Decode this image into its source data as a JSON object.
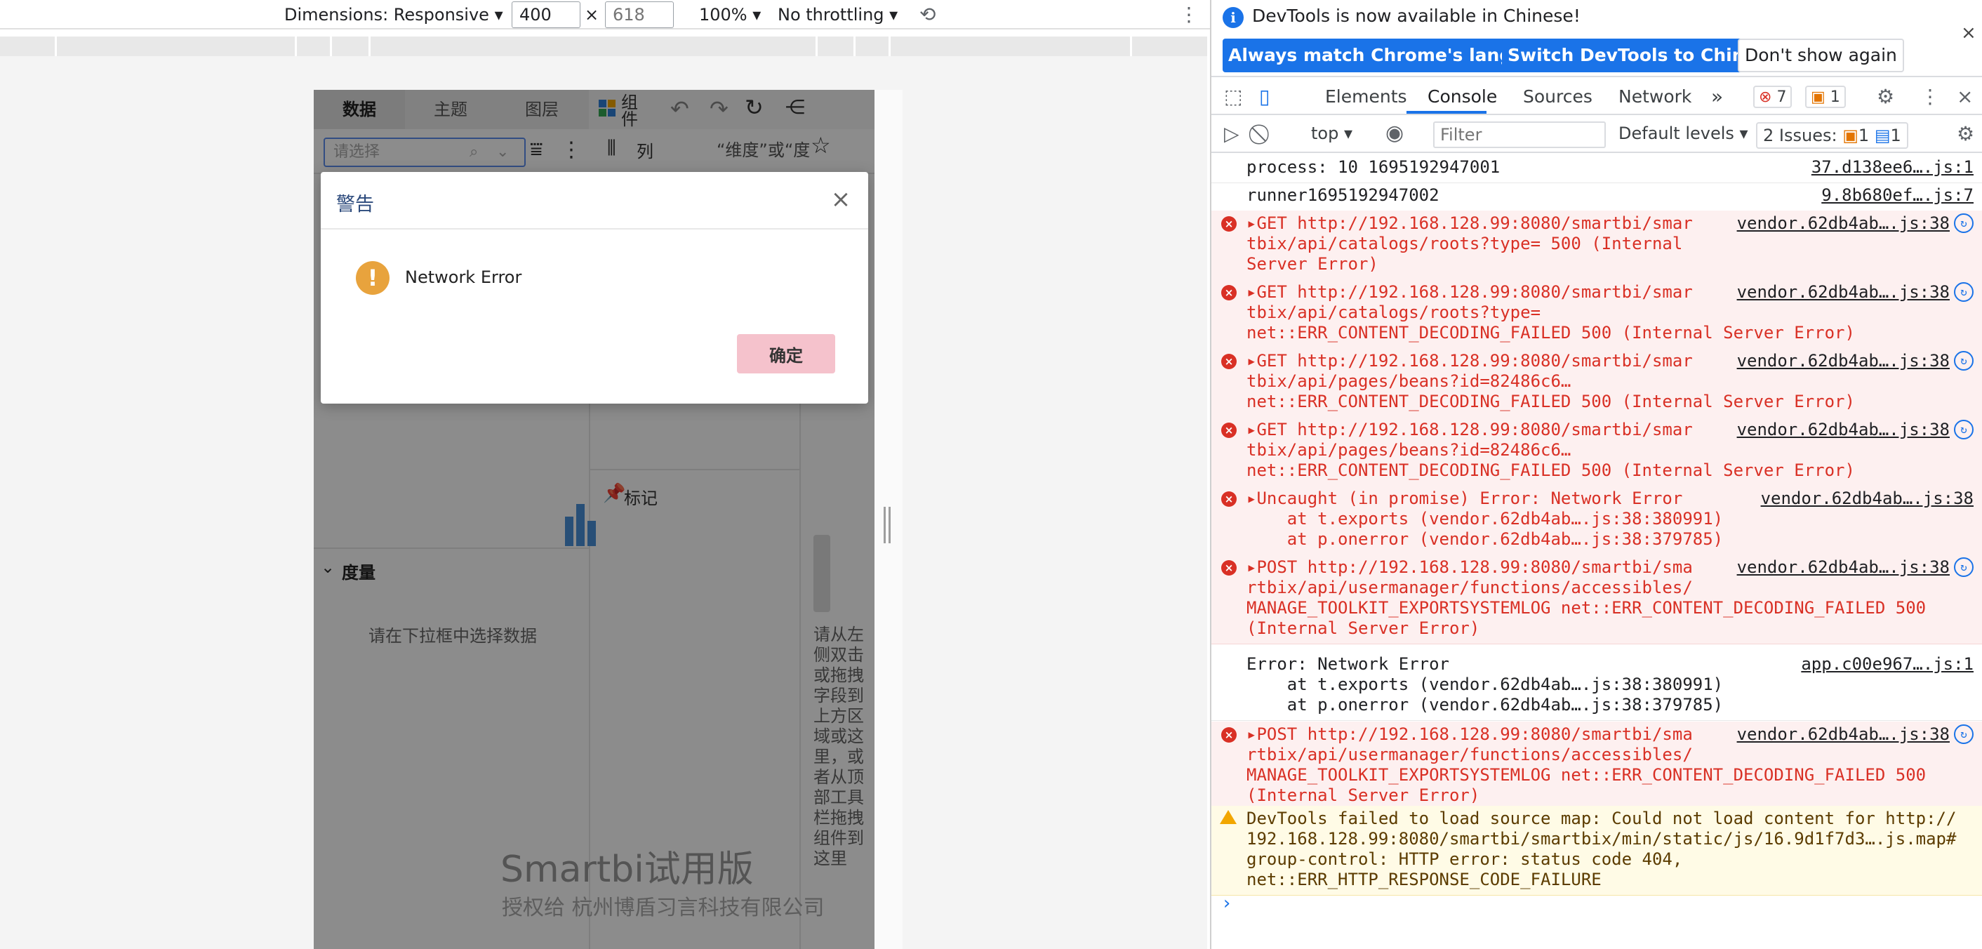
{
  "device_toolbar": {
    "dimensions_label": "Dimensions: Responsive",
    "width_value": "400",
    "height_placeholder": "618",
    "times": "×",
    "zoom": "100%",
    "throttling": "No throttling"
  },
  "app": {
    "tabs": [
      "数据",
      "主题",
      "图层"
    ],
    "components_label": "组件",
    "select_placeholder": "请选择",
    "columns_label": "列",
    "hint_top": "“维度”或“度",
    "marks_label": "标记",
    "measures_label": "度量",
    "select_data_hint": "请在下拉框中选择数据",
    "side_hint": "请从左侧双击或拖拽字段到上方区域或这里，或者从顶部工具栏拖拽组件到这里",
    "watermark_title": "Smartbi试用版",
    "watermark_sub": "授权给 杭州博盾习言科技有限公司"
  },
  "dialog": {
    "title": "警告",
    "message": "Network Error",
    "ok": "确定"
  },
  "devtools": {
    "info_text": "DevTools is now available in Chinese!",
    "btn_match": "Always match Chrome's language",
    "btn_switch": "Switch DevTools to Chinese",
    "btn_dont": "Don't show again",
    "tabs": [
      "Elements",
      "Console",
      "Sources",
      "Network"
    ],
    "errors_count": "7",
    "warnings_count": "1",
    "context": "top",
    "filter_placeholder": "Filter",
    "levels": "Default levels",
    "issues_label": "2 Issues:",
    "issues_warn": "1",
    "issues_info": "1"
  },
  "console": [
    {
      "type": "log",
      "lines": [
        "process: 10 1695192947001"
      ],
      "src": "37.d138ee6….js:1"
    },
    {
      "type": "log",
      "lines": [
        "runner1695192947002"
      ],
      "src": "9.8b680ef….js:7"
    },
    {
      "type": "error",
      "lines": [
        "▸GET http://192.168.128.99:8080/smartbi/smar",
        "tbix/api/catalogs/roots?type= 500 (Internal",
        "Server Error)"
      ],
      "src": "vendor.62db4ab….js:38"
    },
    {
      "type": "error",
      "lines": [
        "▸GET http://192.168.128.99:8080/smartbi/smar",
        "tbix/api/catalogs/roots?type=",
        "net::ERR_CONTENT_DECODING_FAILED 500 (Internal Server Error)"
      ],
      "src": "vendor.62db4ab….js:38"
    },
    {
      "type": "error",
      "lines": [
        "▸GET http://192.168.128.99:8080/smartbi/smar",
        "tbix/api/pages/beans?id=82486c6…",
        "net::ERR_CONTENT_DECODING_FAILED 500 (Internal Server Error)"
      ],
      "src": "vendor.62db4ab….js:38"
    },
    {
      "type": "error",
      "lines": [
        "▸GET http://192.168.128.99:8080/smartbi/smar",
        "tbix/api/pages/beans?id=82486c6…",
        "net::ERR_CONTENT_DECODING_FAILED 500 (Internal Server Error)"
      ],
      "src": "vendor.62db4ab….js:38"
    },
    {
      "type": "error",
      "lines": [
        "▸Uncaught (in promise) Error: Network Error",
        "    at t.exports (vendor.62db4ab….js:38:380991)",
        "    at p.onerror (vendor.62db4ab….js:38:379785)"
      ],
      "src": "vendor.62db4ab….js:38"
    },
    {
      "type": "error",
      "lines": [
        "▸POST http://192.168.128.99:8080/smartbi/sma",
        "rtbix/api/usermanager/functions/accessibles/",
        "MANAGE_TOOLKIT_EXPORTSYSTEMLOG net::ERR_CONTENT_DECODING_FAILED 500",
        "(Internal Server Error)"
      ],
      "src": "vendor.62db4ab….js:38"
    },
    {
      "type": "log",
      "lines": [
        "Error: Network Error",
        "    at t.exports (vendor.62db4ab….js:38:380991)",
        "    at p.onerror (vendor.62db4ab….js:38:379785)"
      ],
      "src": "app.c00e967….js:1"
    },
    {
      "type": "error",
      "lines": [
        "▸POST http://192.168.128.99:8080/smartbi/sma",
        "rtbix/api/usermanager/functions/accessibles/",
        "MANAGE_TOOLKIT_EXPORTSYSTEMLOG net::ERR_CONTENT_DECODING_FAILED 500",
        "(Internal Server Error)"
      ],
      "src": "vendor.62db4ab….js:38"
    },
    {
      "type": "warn",
      "lines": [
        "DevTools failed to load source map: Could not load content for http://",
        "192.168.128.99:8080/smartbi/smartbix/min/static/js/16.9d1f7d3….js.map#",
        "group-control: HTTP error: status code 404,",
        "net::ERR_HTTP_RESPONSE_CODE_FAILURE"
      ],
      "src": ""
    }
  ],
  "prompt_symbol": "›"
}
